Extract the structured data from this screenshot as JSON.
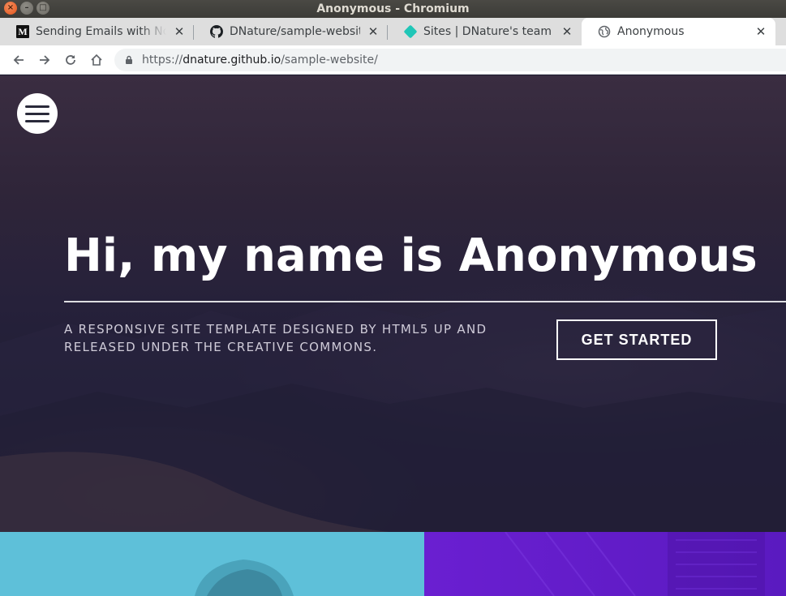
{
  "window": {
    "title": "Anonymous - Chromium"
  },
  "tabs": [
    {
      "title": "Sending Emails with Node",
      "icon": "medium-icon"
    },
    {
      "title": "DNature/sample-website",
      "icon": "github-icon"
    },
    {
      "title": "Sites | DNature's team",
      "icon": "netlify-icon"
    },
    {
      "title": "Anonymous",
      "icon": "globe-icon",
      "active": true
    }
  ],
  "toolbar": {
    "url_scheme": "https://",
    "url_host": "dnature.github.io",
    "url_path": "/sample-website/"
  },
  "hero": {
    "title": "Hi, my name is Anonymous",
    "subtitle": "A responsive site template designed by HTML5 UP and released under the Creative Commons.",
    "cta_label": "GET STARTED"
  },
  "colors": {
    "accent_cyan": "#5ec0d9",
    "accent_purple": "#6a1fd1",
    "hero_bg": "#26213a"
  }
}
